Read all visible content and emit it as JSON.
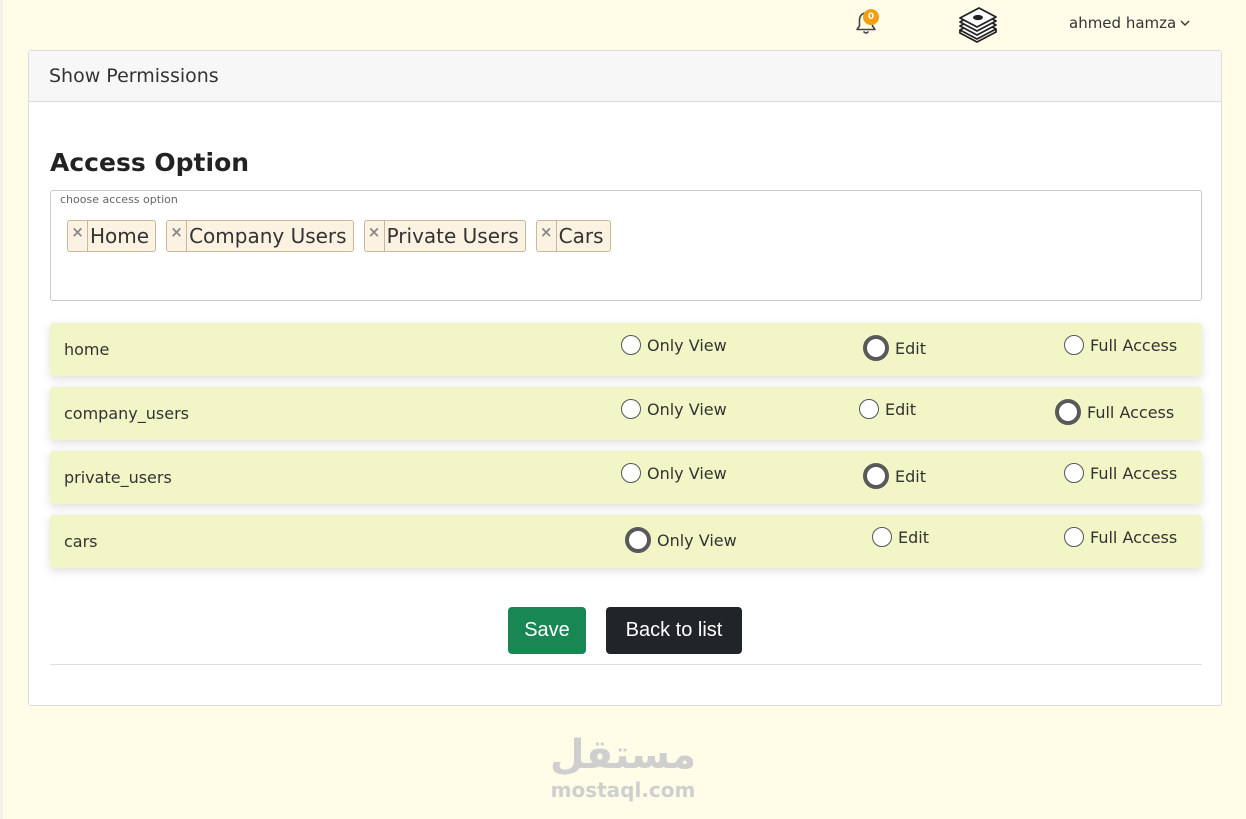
{
  "topbar": {
    "notification_count": "0",
    "user_name": "ahmed hamza"
  },
  "card": {
    "header_title": "Show Permissions",
    "section_title": "Access Option"
  },
  "access_select": {
    "label": "choose access option",
    "chips": [
      "Home",
      "Company Users",
      "Private Users",
      "Cars"
    ],
    "remove_symbol": "×"
  },
  "option_labels": {
    "view": "Only View",
    "edit": "Edit",
    "full": "Full Access"
  },
  "permissions": [
    {
      "name": "home",
      "selected": "edit"
    },
    {
      "name": "company_users",
      "selected": "full"
    },
    {
      "name": "private_users",
      "selected": "edit"
    },
    {
      "name": "cars",
      "selected": "view"
    }
  ],
  "buttons": {
    "save": "Save",
    "back": "Back to list"
  },
  "colors": {
    "page_bg": "#fffde8",
    "row_bg": "#f2f5c6",
    "save": "#198754",
    "back": "#212529",
    "badge": "#f0a010"
  },
  "watermark": {
    "arabic": "مستقل",
    "latin": "mostaql.com"
  }
}
